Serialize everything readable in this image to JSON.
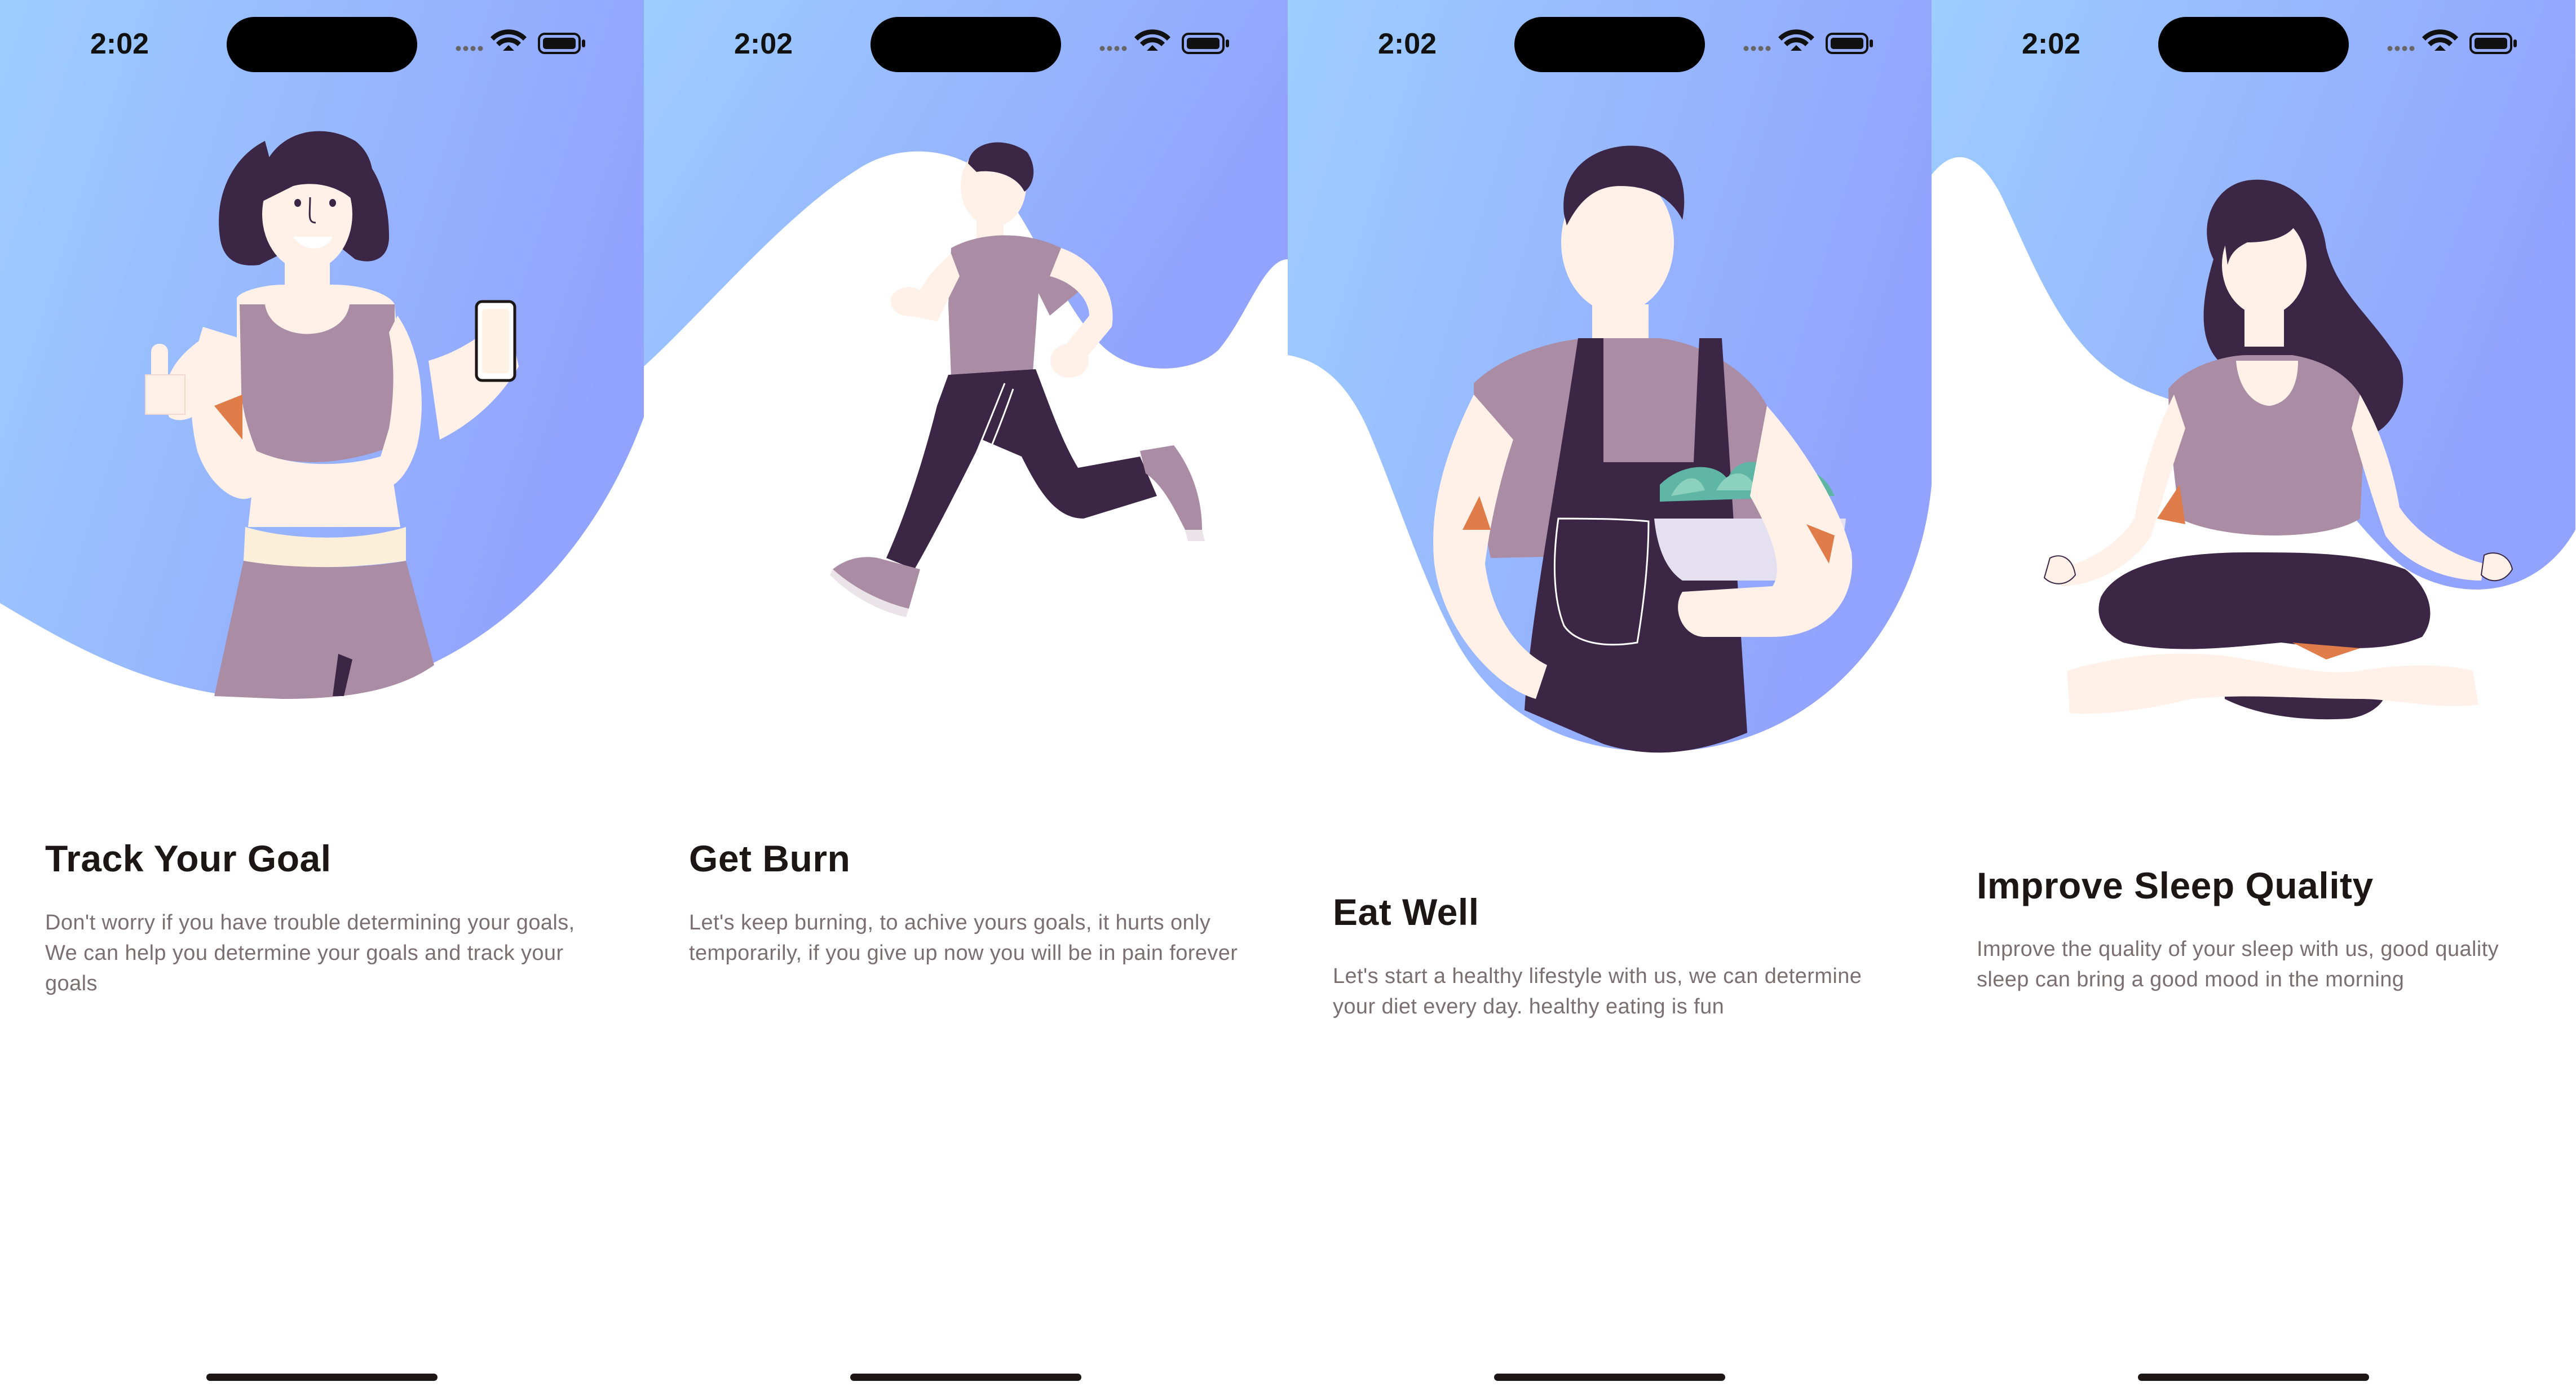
{
  "theme": {
    "gradient_start": "#9DCEFF",
    "gradient_end": "#92A3FD",
    "title_color": "#1D1617",
    "text_color": "#7B6F72",
    "outfit_purple": "#AA8CA5",
    "dark_navy": "#3B2645",
    "skin": "#FFF0E8"
  },
  "screens": [
    {
      "status_time": "2:02",
      "title": "Track Your Goal",
      "description": "Don't worry if you have trouble determining your goals, We can help you determine your goals and track your goals",
      "illustration": "woman-holding-phone-illustration"
    },
    {
      "status_time": "2:02",
      "title": "Get Burn",
      "description": "Let's keep burning, to achive yours goals, it hurts only temporarily, if you give up now you will be in pain forever",
      "illustration": "man-running-illustration"
    },
    {
      "status_time": "2:02",
      "title": "Eat Well",
      "description": "Let's start a healthy lifestyle with us, we can determine your diet every day. healthy eating is fun",
      "illustration": "man-holding-salad-illustration"
    },
    {
      "status_time": "2:02",
      "title": "Improve Sleep Quality",
      "description": "Improve the quality of your sleep with us, good quality sleep can bring a good mood in the morning",
      "illustration": "woman-meditating-illustration"
    }
  ],
  "status_icons": [
    "signal-dots-icon",
    "wifi-icon",
    "battery-icon"
  ]
}
